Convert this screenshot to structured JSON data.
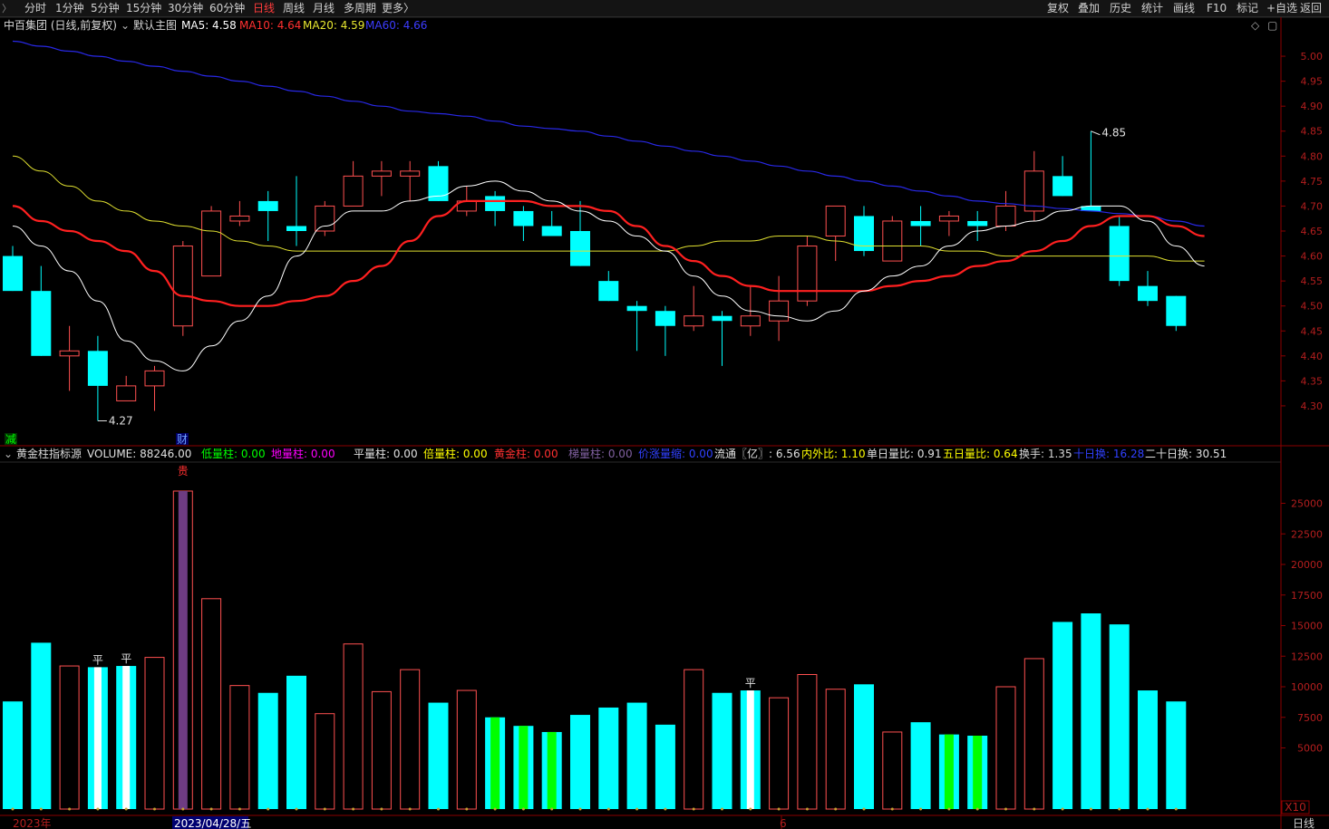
{
  "toolbar": {
    "periods": [
      {
        "label": "分时",
        "active": false
      },
      {
        "label": "1分钟",
        "active": false
      },
      {
        "label": "5分钟",
        "active": false
      },
      {
        "label": "15分钟",
        "active": false
      },
      {
        "label": "30分钟",
        "active": false
      },
      {
        "label": "60分钟",
        "active": false
      },
      {
        "label": "日线",
        "active": true
      },
      {
        "label": "周线",
        "active": false
      },
      {
        "label": "月线",
        "active": false
      },
      {
        "label": "多周期",
        "active": false
      },
      {
        "label": "更多〉",
        "active": false
      }
    ],
    "tools": [
      "复权",
      "叠加",
      "历史",
      "统计",
      "画线",
      "F10",
      "标记",
      "+自选",
      "返回"
    ]
  },
  "price_legend": {
    "title": "中百集团 (日线,前复权)",
    "indicator": "默认主图",
    "ma5": "MA5: 4.58",
    "ma10": "MA10: 4.64",
    "ma20": "MA20: 4.59",
    "ma60": "MA60: 4.66"
  },
  "vol_legend": {
    "title": "黄金柱指标源",
    "volume": "VOLUME: 88246.00",
    "low": "低量柱: 0.00",
    "ground": "地量柱: 0.00",
    "flat": "平量柱: 0.00",
    "double": "倍量柱: 0.00",
    "gold": "黄金柱: 0.00",
    "bar": "梯量柱: 0.00",
    "price_vol": "价涨量缩: 0.00",
    "float": "流通〖亿〗: 6.56",
    "inout": "内外比: 1.10",
    "single": "单日量比: 0.91",
    "five": "五日量比: 0.64",
    "turnover": "换手: 1.35",
    "ten": "十日换: 16.28",
    "twenty": "二十日换: 30.51"
  },
  "colors": {
    "up": "#ff5050",
    "down": "#00ffff",
    "ma5": "#ffffff",
    "ma10": "#ff2020",
    "ma20": "#e0e030",
    "ma60": "#2828e6",
    "axis": "#8c0000",
    "axis_text": "#b41e1e",
    "gold_bar": "#6e3c82",
    "green_bar": "#00ff00",
    "white_bar": "#ffffff"
  },
  "annotations": {
    "jian": "减",
    "cai": "财",
    "gui": "贵",
    "ping": "平",
    "low_mark": "4.27",
    "high_mark": "4.85"
  },
  "axis_labels": {
    "start": "2023年",
    "cursor": "2023/04/28/五",
    "month": "6",
    "x10": "X10",
    "period": "日线"
  },
  "chart_data": [
    {
      "type": "candlestick",
      "y_ticks": [
        4.3,
        4.35,
        4.4,
        4.45,
        4.5,
        4.55,
        4.6,
        4.65,
        4.7,
        4.75,
        4.8,
        4.85,
        4.9,
        4.95,
        5.0
      ],
      "ylim": [
        4.26,
        5.04
      ],
      "candles": [
        [
          4.6,
          4.62,
          4.53,
          4.53
        ],
        [
          4.53,
          4.58,
          4.4,
          4.4
        ],
        [
          4.4,
          4.46,
          4.33,
          4.41
        ],
        [
          4.41,
          4.44,
          4.27,
          4.34
        ],
        [
          4.31,
          4.36,
          4.31,
          4.34
        ],
        [
          4.34,
          4.38,
          4.29,
          4.37
        ],
        [
          4.46,
          4.63,
          4.44,
          4.62
        ],
        [
          4.56,
          4.7,
          4.56,
          4.69
        ],
        [
          4.67,
          4.71,
          4.66,
          4.68
        ],
        [
          4.71,
          4.73,
          4.63,
          4.69
        ],
        [
          4.66,
          4.76,
          4.62,
          4.65
        ],
        [
          4.65,
          4.71,
          4.64,
          4.7
        ],
        [
          4.7,
          4.79,
          4.7,
          4.76
        ],
        [
          4.76,
          4.79,
          4.72,
          4.77
        ],
        [
          4.76,
          4.79,
          4.71,
          4.77
        ],
        [
          4.78,
          4.79,
          4.71,
          4.71
        ],
        [
          4.69,
          4.74,
          4.68,
          4.71
        ],
        [
          4.72,
          4.73,
          4.66,
          4.69
        ],
        [
          4.69,
          4.7,
          4.63,
          4.66
        ],
        [
          4.66,
          4.69,
          4.64,
          4.64
        ],
        [
          4.65,
          4.71,
          4.58,
          4.58
        ],
        [
          4.55,
          4.57,
          4.51,
          4.51
        ],
        [
          4.5,
          4.51,
          4.41,
          4.49
        ],
        [
          4.49,
          4.5,
          4.4,
          4.46
        ],
        [
          4.46,
          4.54,
          4.45,
          4.48
        ],
        [
          4.48,
          4.49,
          4.38,
          4.47
        ],
        [
          4.46,
          4.54,
          4.44,
          4.48
        ],
        [
          4.47,
          4.56,
          4.43,
          4.51
        ],
        [
          4.51,
          4.64,
          4.5,
          4.62
        ],
        [
          4.64,
          4.7,
          4.59,
          4.7
        ],
        [
          4.68,
          4.7,
          4.6,
          4.61
        ],
        [
          4.59,
          4.68,
          4.59,
          4.67
        ],
        [
          4.67,
          4.7,
          4.62,
          4.66
        ],
        [
          4.67,
          4.69,
          4.64,
          4.68
        ],
        [
          4.67,
          4.69,
          4.63,
          4.66
        ],
        [
          4.66,
          4.73,
          4.65,
          4.7
        ],
        [
          4.69,
          4.81,
          4.67,
          4.77
        ],
        [
          4.76,
          4.8,
          4.72,
          4.72
        ],
        [
          4.7,
          4.85,
          4.69,
          4.69
        ],
        [
          4.66,
          4.68,
          4.54,
          4.55
        ],
        [
          4.54,
          4.57,
          4.5,
          4.51
        ],
        [
          4.52,
          4.52,
          4.45,
          4.46
        ]
      ],
      "ma5": [
        4.66,
        4.62,
        4.57,
        4.51,
        4.43,
        4.39,
        4.37,
        4.42,
        4.47,
        4.52,
        4.6,
        4.66,
        4.69,
        4.69,
        4.71,
        4.72,
        4.74,
        4.75,
        4.73,
        4.71,
        4.69,
        4.67,
        4.64,
        4.61,
        4.56,
        4.52,
        4.49,
        4.48,
        4.47,
        4.49,
        4.53,
        4.56,
        4.58,
        4.62,
        4.65,
        4.66,
        4.67,
        4.69,
        4.7,
        4.7,
        4.67,
        4.62,
        4.58
      ],
      "ma10": [
        4.7,
        4.67,
        4.65,
        4.63,
        4.61,
        4.57,
        4.52,
        4.51,
        4.5,
        4.5,
        4.51,
        4.52,
        4.55,
        4.58,
        4.63,
        4.68,
        4.71,
        4.71,
        4.71,
        4.7,
        4.7,
        4.69,
        4.66,
        4.62,
        4.59,
        4.56,
        4.54,
        4.53,
        4.53,
        4.53,
        4.53,
        4.54,
        4.55,
        4.56,
        4.58,
        4.59,
        4.61,
        4.63,
        4.66,
        4.68,
        4.68,
        4.66,
        4.64
      ],
      "ma20": [
        4.8,
        4.77,
        4.74,
        4.71,
        4.69,
        4.67,
        4.66,
        4.65,
        4.63,
        4.62,
        4.61,
        4.61,
        4.61,
        4.61,
        4.61,
        4.61,
        4.61,
        4.61,
        4.61,
        4.61,
        4.61,
        4.61,
        4.61,
        4.61,
        4.62,
        4.63,
        4.63,
        4.64,
        4.64,
        4.63,
        4.62,
        4.62,
        4.62,
        4.61,
        4.61,
        4.6,
        4.6,
        4.6,
        4.6,
        4.6,
        4.6,
        4.59,
        4.59
      ],
      "ma60": [
        5.03,
        5.02,
        5.01,
        5.0,
        4.99,
        4.98,
        4.97,
        4.96,
        4.95,
        4.94,
        4.93,
        4.92,
        4.91,
        4.9,
        4.89,
        4.885,
        4.88,
        4.87,
        4.86,
        4.855,
        4.85,
        4.84,
        4.83,
        4.82,
        4.81,
        4.8,
        4.79,
        4.78,
        4.77,
        4.76,
        4.75,
        4.74,
        4.73,
        4.72,
        4.71,
        4.705,
        4.7,
        4.695,
        4.69,
        4.685,
        4.68,
        4.67,
        4.66
      ]
    },
    {
      "type": "bar",
      "y_ticks": [
        5000,
        7500,
        10000,
        12500,
        15000,
        17500,
        20000,
        22500,
        25000
      ],
      "ylim": [
        0,
        26000
      ],
      "volumes": [
        8800,
        13600,
        11700,
        11600,
        11700,
        12400,
        26000,
        17200,
        10100,
        9500,
        10900,
        7800,
        13500,
        9600,
        11400,
        8700,
        9700,
        7500,
        6800,
        6300,
        7700,
        8300,
        8700,
        6900,
        11400,
        9500,
        9700,
        9100,
        11000,
        9800,
        10200,
        6300,
        7100,
        6100,
        6000,
        10000,
        12300,
        15300,
        16000,
        15100,
        9700,
        8800
      ],
      "styles": [
        "down",
        "down",
        "up",
        "white",
        "white",
        "up",
        "gold",
        "up",
        "up",
        "down",
        "down",
        "up",
        "up",
        "up",
        "up",
        "down",
        "up",
        "green",
        "green",
        "green",
        "down",
        "down",
        "down",
        "down",
        "up",
        "down",
        "white",
        "up",
        "up",
        "up",
        "down",
        "up",
        "down",
        "green",
        "green",
        "up",
        "up",
        "down",
        "down",
        "down",
        "down",
        "down"
      ]
    }
  ]
}
